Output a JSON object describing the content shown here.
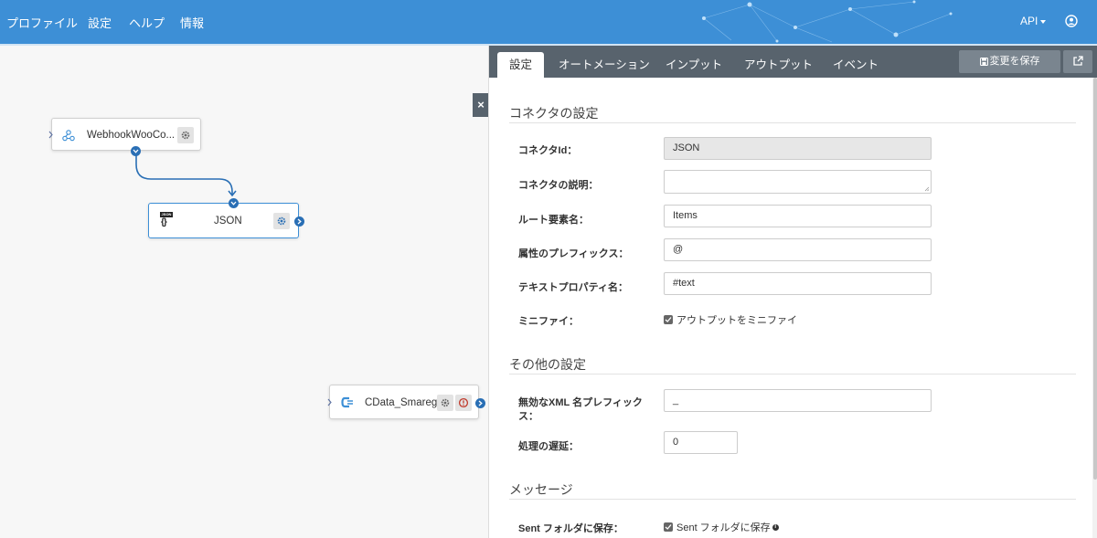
{
  "nav": {
    "items": [
      "プロファイル",
      "設定",
      "ヘルプ",
      "情報"
    ],
    "api_label": "API"
  },
  "canvas": {
    "nodes": {
      "webhook": {
        "label": "WebhookWooCo..."
      },
      "json": {
        "label": "JSON",
        "icon_text": "JSON"
      },
      "smaregi": {
        "label": "CData_Smaregi"
      }
    }
  },
  "panel": {
    "close_label": "×",
    "tabs": [
      "設定",
      "オートメーション",
      "インプット",
      "アウトプット",
      "イベント"
    ],
    "save_label": "変更を保存",
    "sections": {
      "connector": "コネクタの設定",
      "other": "その他の設定",
      "message": "メッセージ"
    },
    "fields": {
      "connector_id": {
        "label": "コネクタId：",
        "value": "JSON"
      },
      "description": {
        "label": "コネクタの説明：",
        "value": ""
      },
      "root_element": {
        "label": "ルート要素名：",
        "value": "Items"
      },
      "attr_prefix": {
        "label": "属性のプレフィックス：",
        "value": "@"
      },
      "text_prop": {
        "label": "テキストプロパティ名：",
        "value": "#text"
      },
      "minify": {
        "label": "ミニファイ：",
        "checkbox_label": "アウトプットをミニファイ",
        "checked": true
      },
      "invalid_xml_prefix": {
        "label_line1": "無効なXML 名プレフィック",
        "label_line2": "ス：",
        "value": "_"
      },
      "delay": {
        "label": "処理の遅延：",
        "value": "0"
      },
      "sent_folder": {
        "label": "Sent フォルダに保存：",
        "checkbox_label": "Sent フォルダに保存",
        "checked": true,
        "info": "i"
      }
    }
  },
  "colors": {
    "topbar": "#3d8fd6",
    "tabbar": "#58636d",
    "port": "#2a6fb5"
  }
}
